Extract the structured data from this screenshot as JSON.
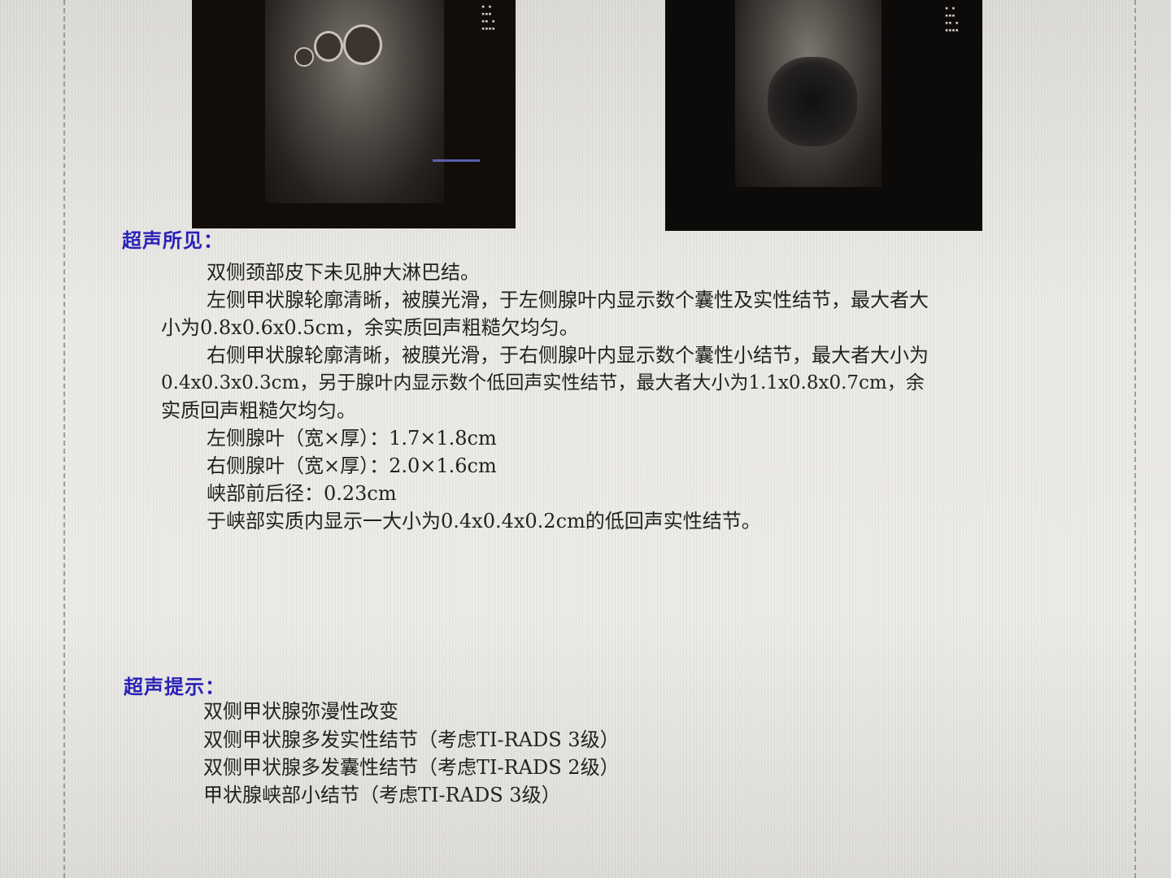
{
  "findings": {
    "title": "超声所见：",
    "lines": [
      "双侧颈部皮下未见肿大淋巴结。",
      "左侧甲状腺轮廓清晰，被膜光滑，于左侧腺叶内显示数个囊性及实性结节，最大者大",
      "小为0.8x0.6x0.5cm，余实质回声粗糙欠均匀。",
      "右侧甲状腺轮廓清晰，被膜光滑，于右侧腺叶内显示数个囊性小结节，最大者大小为",
      "0.4x0.3x0.3cm，另于腺叶内显示数个低回声实性结节，最大者大小为1.1x0.8x0.7cm，余",
      "实质回声粗糙欠均匀。",
      "左侧腺叶（宽×厚）：1.7×1.8cm",
      "右侧腺叶（宽×厚）：2.0×1.6cm",
      "峡部前后径：0.23cm",
      "于峡部实质内显示一大小为0.4x0.4x0.2cm的低回声实性结节。"
    ]
  },
  "impression": {
    "title": "超声提示：",
    "lines": [
      "双侧甲状腺弥漫性改变",
      "双侧甲状腺多发实性结节（考虑TI-RADS 3级）",
      "双侧甲状腺多发囊性结节（考虑TI-RADS 2级）",
      "甲状腺峡部小结节（考虑TI-RADS 3级）"
    ]
  },
  "colors": {
    "heading": "#2a21b8",
    "text": "#222222",
    "screen": "#e9e8e4"
  }
}
